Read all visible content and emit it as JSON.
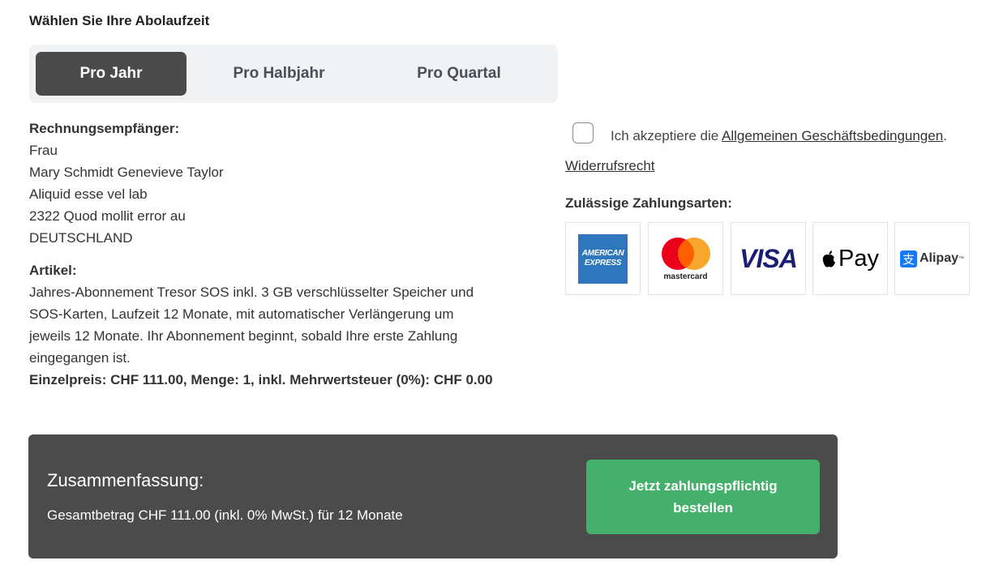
{
  "period_section": {
    "title": "Wählen Sie Ihre Abolaufzeit",
    "options": [
      {
        "label": "Pro Jahr",
        "active": true
      },
      {
        "label": "Pro Halbjahr",
        "active": false
      },
      {
        "label": "Pro Quartal",
        "active": false
      }
    ]
  },
  "recipient": {
    "heading": "Rechnungsempfänger:",
    "lines": [
      "Frau",
      "Mary Schmidt Genevieve Taylor",
      "Aliquid esse vel lab",
      "2322 Quod mollit error au",
      "DEUTSCHLAND"
    ]
  },
  "article": {
    "heading": "Artikel:",
    "description_lines": [
      "Jahres-Abonnement Tresor SOS inkl. 3 GB verschlüsselter Speicher und",
      "SOS-Karten, Laufzeit 12 Monate, mit automatischer Verlängerung um",
      "jeweils 12 Monate. Ihr Abonnement beginnt, sobald Ihre erste Zahlung",
      "eingegangen ist."
    ],
    "price_line": "Einzelpreis: CHF 111.00, Menge: 1, inkl. Mehrwertsteuer (0%): CHF 0.00"
  },
  "terms": {
    "prefix": "Ich akzeptiere die ",
    "link": "Allgemeinen Geschäftsbedingungen",
    "suffix": ".",
    "checked": false,
    "revocation_link": "Widerrufsrecht"
  },
  "payment": {
    "title": "Zulässige Zahlungsarten:",
    "methods": [
      "American Express",
      "Mastercard",
      "Visa",
      "Apple Pay",
      "Alipay"
    ],
    "amex_text": [
      "AMERICAN",
      "EXPRESS"
    ],
    "mastercard_text": "mastercard",
    "visa_text": "VISA",
    "applepay_text": "Pay",
    "alipay_text": "Alipay",
    "alipay_mark": "支",
    "tm": "™",
    "apple_glyph": ""
  },
  "summary": {
    "title": "Zusammenfassung:",
    "total": "Gesamtbetrag CHF 111.00 (inkl. 0% MwSt.) für 12 Monate",
    "order_button": "Jetzt zahlungspflichtig bestellen"
  },
  "colors": {
    "active_tab": "#4a4a4a",
    "summary_bg": "#4b4b4b",
    "order_button": "#45b06b",
    "amex_blue": "#2e77bc",
    "visa_blue": "#1a1f71",
    "mastercard_red": "#eb001b",
    "mastercard_orange": "#f79e1b",
    "alipay_blue": "#1677ff"
  }
}
